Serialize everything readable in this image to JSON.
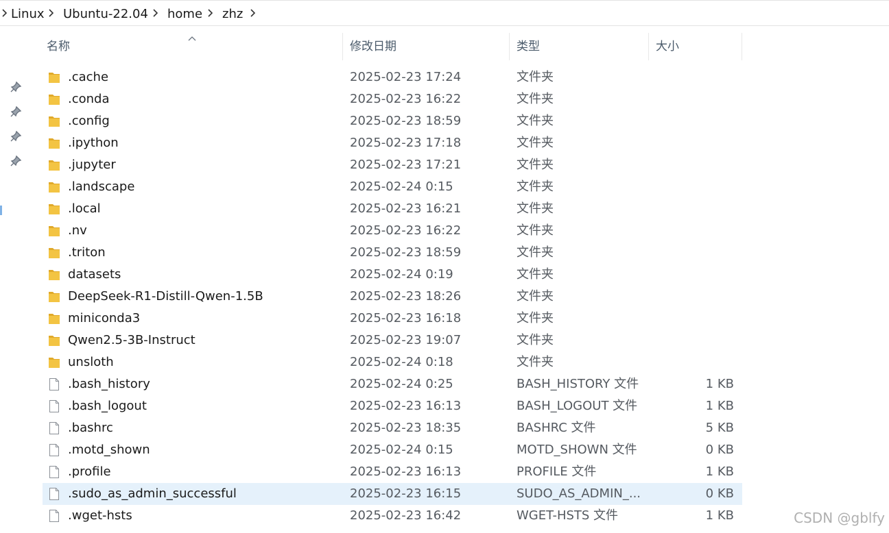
{
  "breadcrumb": [
    "Linux",
    "Ubuntu-22.04",
    "home",
    "zhz"
  ],
  "columns": {
    "name": "名称",
    "date": "修改日期",
    "type": "类型",
    "size": "大小"
  },
  "colors": {
    "folder": "#f3c443",
    "folder_dark": "#e0a92a",
    "selected_row": "#e5f1fb"
  },
  "rows": [
    {
      "icon": "folder-icon",
      "name": ".cache",
      "date": "2025-02-23 17:24",
      "type": "文件夹",
      "size": ""
    },
    {
      "icon": "folder-icon",
      "name": ".conda",
      "date": "2025-02-23 16:22",
      "type": "文件夹",
      "size": ""
    },
    {
      "icon": "folder-icon",
      "name": ".config",
      "date": "2025-02-23 18:59",
      "type": "文件夹",
      "size": ""
    },
    {
      "icon": "folder-icon",
      "name": ".ipython",
      "date": "2025-02-23 17:18",
      "type": "文件夹",
      "size": ""
    },
    {
      "icon": "folder-icon",
      "name": ".jupyter",
      "date": "2025-02-23 17:21",
      "type": "文件夹",
      "size": ""
    },
    {
      "icon": "folder-icon",
      "name": ".landscape",
      "date": "2025-02-24 0:15",
      "type": "文件夹",
      "size": ""
    },
    {
      "icon": "folder-icon",
      "name": ".local",
      "date": "2025-02-23 16:21",
      "type": "文件夹",
      "size": ""
    },
    {
      "icon": "folder-icon",
      "name": ".nv",
      "date": "2025-02-23 16:22",
      "type": "文件夹",
      "size": ""
    },
    {
      "icon": "folder-icon",
      "name": ".triton",
      "date": "2025-02-23 18:59",
      "type": "文件夹",
      "size": ""
    },
    {
      "icon": "folder-icon",
      "name": "datasets",
      "date": "2025-02-24 0:19",
      "type": "文件夹",
      "size": ""
    },
    {
      "icon": "folder-icon",
      "name": "DeepSeek-R1-Distill-Qwen-1.5B",
      "date": "2025-02-23 18:26",
      "type": "文件夹",
      "size": ""
    },
    {
      "icon": "folder-icon",
      "name": "miniconda3",
      "date": "2025-02-23 16:18",
      "type": "文件夹",
      "size": ""
    },
    {
      "icon": "folder-icon",
      "name": "Qwen2.5-3B-Instruct",
      "date": "2025-02-23 19:07",
      "type": "文件夹",
      "size": ""
    },
    {
      "icon": "folder-icon",
      "name": "unsloth",
      "date": "2025-02-24 0:18",
      "type": "文件夹",
      "size": ""
    },
    {
      "icon": "file-icon",
      "name": ".bash_history",
      "date": "2025-02-24 0:25",
      "type": "BASH_HISTORY 文件",
      "size": "1 KB"
    },
    {
      "icon": "file-icon",
      "name": ".bash_logout",
      "date": "2025-02-23 16:13",
      "type": "BASH_LOGOUT 文件",
      "size": "1 KB"
    },
    {
      "icon": "file-icon",
      "name": ".bashrc",
      "date": "2025-02-23 18:35",
      "type": "BASHRC 文件",
      "size": "5 KB"
    },
    {
      "icon": "file-icon",
      "name": ".motd_shown",
      "date": "2025-02-24 0:15",
      "type": "MOTD_SHOWN 文件",
      "size": "0 KB"
    },
    {
      "icon": "file-icon",
      "name": ".profile",
      "date": "2025-02-23 16:13",
      "type": "PROFILE 文件",
      "size": "1 KB"
    },
    {
      "icon": "file-icon",
      "name": ".sudo_as_admin_successful",
      "date": "2025-02-23 16:15",
      "type": "SUDO_AS_ADMIN_...",
      "size": "0 KB",
      "selected": true
    },
    {
      "icon": "file-icon",
      "name": ".wget-hsts",
      "date": "2025-02-23 16:42",
      "type": "WGET-HSTS 文件",
      "size": "1 KB"
    }
  ],
  "watermark": "CSDN @gblfy"
}
